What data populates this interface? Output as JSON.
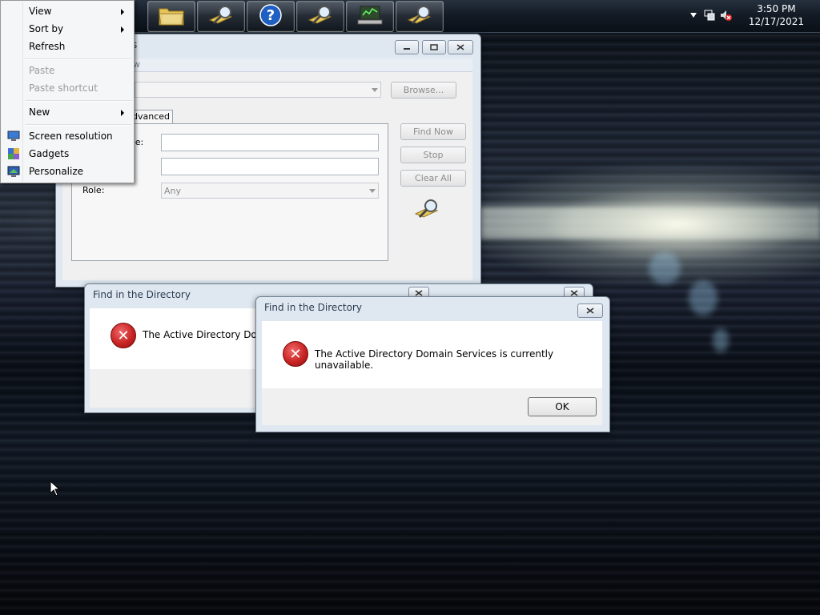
{
  "taskbar": {
    "buttons": [
      {
        "name": "file-explorer-taskbar-button",
        "icon": "folder-icon"
      },
      {
        "name": "find-taskbar-button-1",
        "icon": "magnifier-icon"
      },
      {
        "name": "help-taskbar-button",
        "icon": "help-icon"
      },
      {
        "name": "find-taskbar-button-2",
        "icon": "magnifier-icon"
      },
      {
        "name": "computer-management-taskbar-button",
        "icon": "monitor-icon"
      },
      {
        "name": "find-taskbar-button-3",
        "icon": "magnifier-icon"
      }
    ],
    "clock": {
      "time": "3:50 PM",
      "date": "12/17/2021"
    }
  },
  "context_menu": {
    "items": [
      {
        "label": "View",
        "submenu": true,
        "enabled": true
      },
      {
        "label": "Sort by",
        "submenu": true,
        "enabled": true
      },
      {
        "label": "Refresh",
        "submenu": false,
        "enabled": true
      },
      {
        "label": "Paste",
        "submenu": false,
        "enabled": false
      },
      {
        "label": "Paste shortcut",
        "submenu": false,
        "enabled": false
      },
      {
        "label": "New",
        "submenu": true,
        "enabled": true
      },
      {
        "label": "Screen resolution",
        "submenu": false,
        "enabled": true,
        "icon": "screen-resolution-icon"
      },
      {
        "label": "Gadgets",
        "submenu": false,
        "enabled": true,
        "icon": "gadgets-icon"
      },
      {
        "label": "Personalize",
        "submenu": false,
        "enabled": true,
        "icon": "personalize-icon"
      }
    ]
  },
  "find_window": {
    "title_partial": "ters",
    "menubar_partial": "w",
    "browse_label": "Browse...",
    "tab_advanced_partial": "dvanced",
    "name_label_partial": "me:",
    "role_label": "Role:",
    "role_value": "Any",
    "find_now_label": "Find Now",
    "stop_label": "Stop",
    "clear_all_label": "Clear All"
  },
  "dialog_back": {
    "title": "Find in the Directory",
    "message_partial": "The Active Directory Doma"
  },
  "dialog_front": {
    "title": "Find in the Directory",
    "message": "The Active Directory Domain Services is currently unavailable.",
    "ok_label": "OK"
  }
}
